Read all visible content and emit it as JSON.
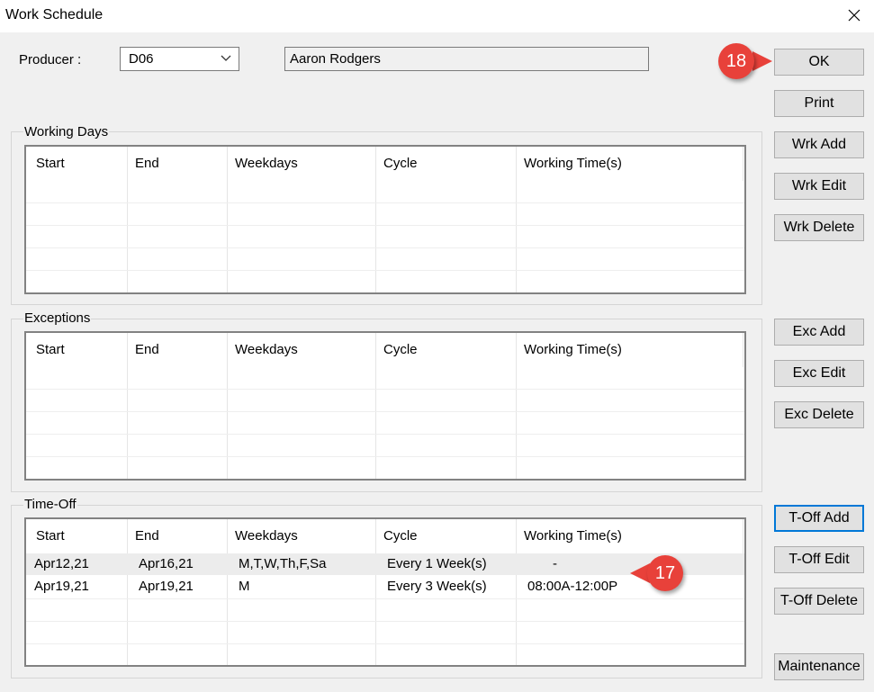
{
  "window": {
    "title": "Work Schedule"
  },
  "producer": {
    "label": "Producer :",
    "code": "D06",
    "name": "Aaron Rodgers"
  },
  "columns": [
    "Start",
    "End",
    "Weekdays",
    "Cycle",
    "Working Time(s)"
  ],
  "working_days": {
    "caption": "Working Days",
    "rows": []
  },
  "exceptions": {
    "caption": "Exceptions",
    "rows": []
  },
  "time_off": {
    "caption": "Time-Off",
    "rows": [
      {
        "start": "Apr12,21",
        "end": "Apr16,21",
        "weekdays": "M,T,W,Th,F,Sa",
        "cycle": "Every 1 Week(s)",
        "time": "-"
      },
      {
        "start": "Apr19,21",
        "end": "Apr19,21",
        "weekdays": "M",
        "cycle": "Every 3 Week(s)",
        "time": "08:00A-12:00P"
      }
    ]
  },
  "buttons": {
    "ok": "OK",
    "print": "Print",
    "wrk_add": "Wrk Add",
    "wrk_edit": "Wrk Edit",
    "wrk_delete": "Wrk Delete",
    "exc_add": "Exc Add",
    "exc_edit": "Exc Edit",
    "exc_delete": "Exc Delete",
    "toff_add": "T-Off Add",
    "toff_edit": "T-Off Edit",
    "toff_delete": "T-Off Delete",
    "maintenance": "Maintenance"
  },
  "callouts": {
    "ok_step": "18",
    "list_step": "17"
  },
  "colors": {
    "callout": "#e8413a",
    "focus_border": "#0078d7",
    "dialog_bg": "#f0f0f0"
  },
  "icons": {
    "close": "close-icon",
    "dropdown": "chevron-down-icon"
  }
}
